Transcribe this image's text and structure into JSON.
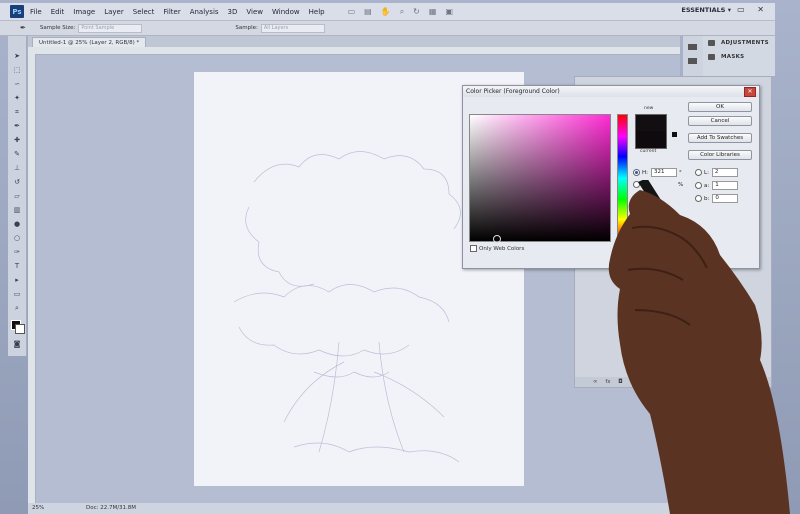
{
  "app": {
    "logo": "Ps",
    "workspace": "ESSENTIALS ▾"
  },
  "menu": [
    "File",
    "Edit",
    "Image",
    "Layer",
    "Select",
    "Filter",
    "Analysis",
    "3D",
    "View",
    "Window",
    "Help"
  ],
  "options_bar": {
    "sample_size_label": "Sample Size:",
    "sample_size_value": "Point Sample",
    "sample_label": "Sample:",
    "sample_value": "All Layers"
  },
  "document": {
    "tab_title": "Untitled-1 @ 25% (Layer 2, RGB/8) *"
  },
  "status": {
    "zoom": "25%",
    "doc_info": "Doc: 22.7M/31.8M"
  },
  "panels": {
    "adjustments": "ADJUSTMENTS",
    "masks": "MASKS"
  },
  "color_picker": {
    "title": "Color Picker (Foreground Color)",
    "new_label": "new",
    "current_label": "current",
    "buttons": {
      "ok": "OK",
      "cancel": "Cancel",
      "add_swatches": "Add To Swatches",
      "libraries": "Color Libraries"
    },
    "hsb": {
      "h_label": "H:",
      "h_value": "321",
      "h_unit": "°",
      "s_unit": "%"
    },
    "lab": {
      "l_label": "L:",
      "l_value": "2",
      "a_label": "a:",
      "a_value": "1",
      "b_label": "b:",
      "b_value": "0"
    },
    "only_web": "Only Web Colors",
    "new_color": "#120e12",
    "current_color": "#0e0a0e"
  }
}
